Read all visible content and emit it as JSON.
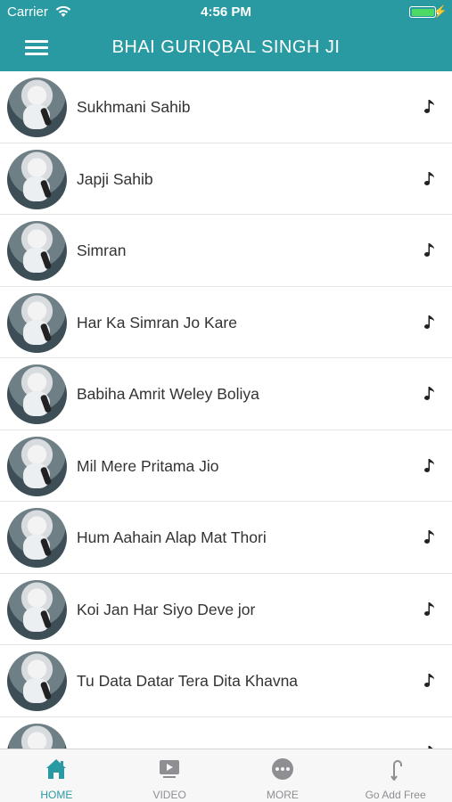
{
  "status_bar": {
    "carrier": "Carrier",
    "time": "4:56 PM",
    "battery_level": 1.0,
    "battery_color": "#4cd964"
  },
  "nav": {
    "title": "BHAI GURIQBAL SINGH JI",
    "menu_icon": "hamburger-menu-icon",
    "color": "#2a9aa2"
  },
  "tracks": [
    {
      "title": "Sukhmani Sahib",
      "icon": "music-note-icon"
    },
    {
      "title": "Japji Sahib",
      "icon": "music-note-icon"
    },
    {
      "title": "Simran",
      "icon": "music-note-icon"
    },
    {
      "title": "Har Ka Simran Jo Kare",
      "icon": "music-note-icon"
    },
    {
      "title": "Babiha Amrit Weley Boliya",
      "icon": "music-note-icon"
    },
    {
      "title": "Mil Mere Pritama Jio",
      "icon": "music-note-icon"
    },
    {
      "title": "Hum Aahain Alap Mat Thori",
      "icon": "music-note-icon"
    },
    {
      "title": "Koi Jan Har Siyo Deve jor",
      "icon": "music-note-icon"
    },
    {
      "title": "Tu Data Datar Tera Dita Khavna",
      "icon": "music-note-icon"
    },
    {
      "title": "",
      "icon": "music-note-icon"
    }
  ],
  "tabs": [
    {
      "label": "HOME",
      "icon": "home-icon",
      "active": true
    },
    {
      "label": "VIDEO",
      "icon": "video-icon",
      "active": false
    },
    {
      "label": "MORE",
      "icon": "more-icon",
      "active": false
    },
    {
      "label": "Go Add Free",
      "icon": "ad-free-icon",
      "active": false
    }
  ],
  "colors": {
    "accent": "#2a9aa2",
    "tab_inactive": "#8e8e93"
  }
}
